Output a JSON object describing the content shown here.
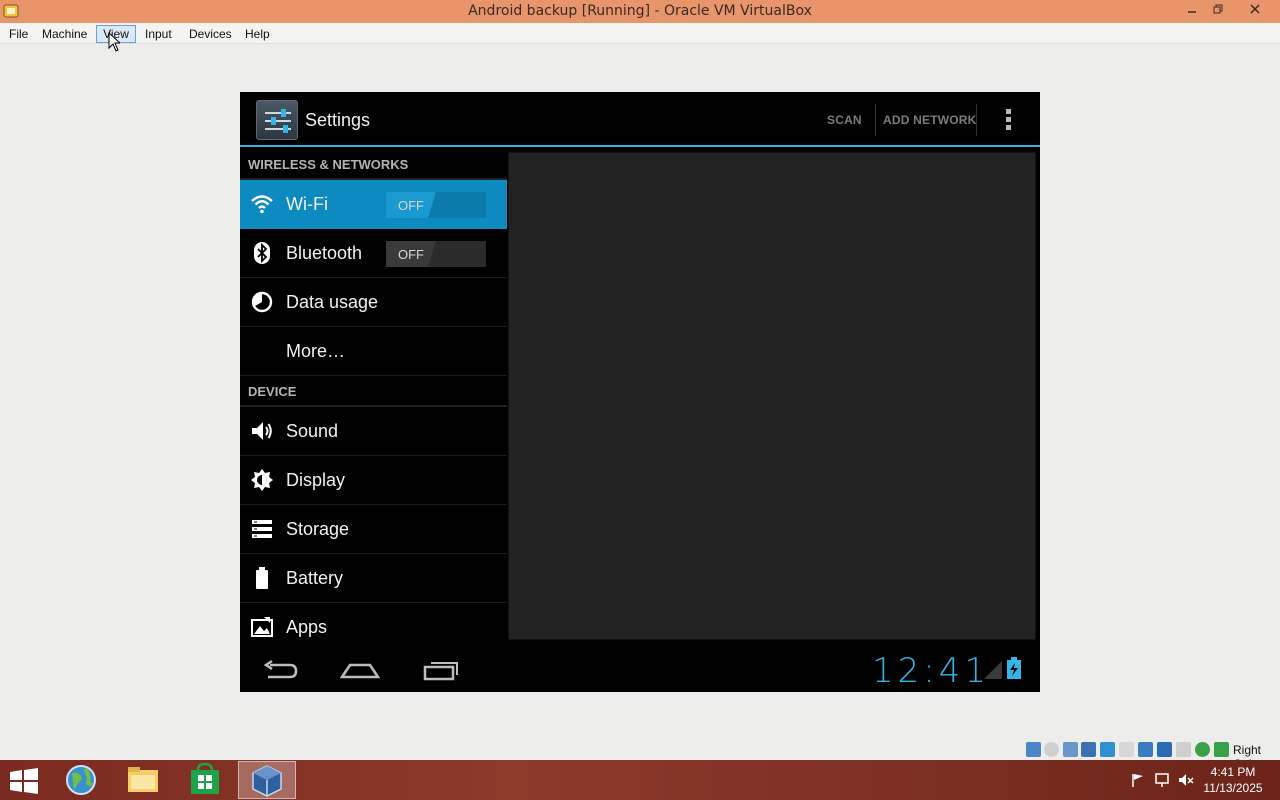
{
  "window": {
    "title": "Android backup [Running] - Oracle VM VirtualBox",
    "min_icon": "minimize-icon",
    "max_icon": "restore-icon",
    "close_icon": "close-icon"
  },
  "menubar": {
    "items": [
      {
        "label": "File"
      },
      {
        "label": "Machine"
      },
      {
        "label": "View"
      },
      {
        "label": "Input"
      },
      {
        "label": "Devices"
      },
      {
        "label": "Help"
      }
    ],
    "active": "View"
  },
  "android": {
    "actionbar": {
      "title": "Settings",
      "scan_label": "SCAN",
      "add_network_label": "ADD NETWORK"
    },
    "sections": {
      "wireless": "WIRELESS & NETWORKS",
      "device": "DEVICE"
    },
    "wireless_items": [
      {
        "label": "Wi-Fi",
        "icon": "wifi-icon",
        "toggle": "OFF",
        "selected": true
      },
      {
        "label": "Bluetooth",
        "icon": "bluetooth-icon",
        "toggle": "OFF"
      },
      {
        "label": "Data usage",
        "icon": "data-usage-icon"
      },
      {
        "label": "More…"
      }
    ],
    "device_items": [
      {
        "label": "Sound",
        "icon": "speaker-icon"
      },
      {
        "label": "Display",
        "icon": "brightness-icon"
      },
      {
        "label": "Storage",
        "icon": "storage-icon"
      },
      {
        "label": "Battery",
        "icon": "battery-icon"
      },
      {
        "label": "Apps",
        "icon": "apps-icon"
      }
    ],
    "status": {
      "clock": "12:41"
    }
  },
  "vbox_status": {
    "host_key": "Right Ctrl"
  },
  "taskbar": {
    "time": "4:41 PM",
    "date": "11/13/2025"
  },
  "colors": {
    "accent": "#33b5e5",
    "selected_row": "#0d8ac0",
    "titlebar": "#e8956c",
    "taskbar": "#7a2a20"
  }
}
